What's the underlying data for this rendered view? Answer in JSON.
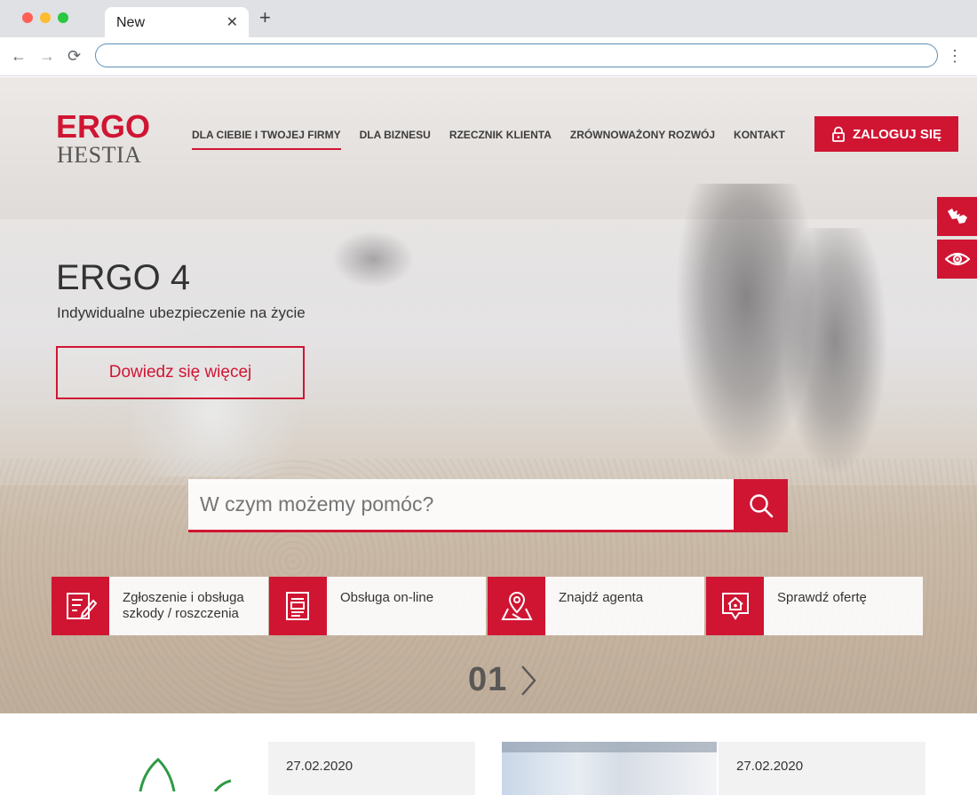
{
  "browser": {
    "tab_title": "New",
    "tab_close": "✕",
    "new_tab": "+",
    "address_value": "",
    "back": "←",
    "forward": "→",
    "reload": "⟳",
    "menu": "⋮"
  },
  "header": {
    "logo_ergo": "ERGO",
    "logo_hestia": "HESTIA",
    "nav": [
      {
        "label": "DLA CIEBIE I TWOJEJ FIRMY",
        "active": true
      },
      {
        "label": "DLA BIZNESU",
        "active": false
      },
      {
        "label": "RZECZNIK KLIENTA",
        "active": false
      },
      {
        "label": "ZRÓWNOWAŻONY ROZWÓJ",
        "active": false
      },
      {
        "label": "KONTAKT",
        "active": false
      }
    ],
    "login_label": "ZALOGUJ SIĘ"
  },
  "side_tabs": {
    "a11y_icon": "sign-language-icon",
    "eye_icon": "eye-icon"
  },
  "hero": {
    "title": "ERGO 4",
    "subtitle": "Indywidualne ubezpieczenie na życie",
    "cta_label": "Dowiedz się więcej",
    "search_placeholder": "W czym możemy pomóc?",
    "slide_number": "01"
  },
  "tiles": [
    {
      "label": "Zgłoszenie i obsługa szkody / roszczenia",
      "icon": "claim-form-icon"
    },
    {
      "label": "Obsługa on-line",
      "icon": "online-document-icon"
    },
    {
      "label": "Znajdź agenta",
      "icon": "map-pin-icon"
    },
    {
      "label": "Sprawdź ofertę",
      "icon": "home-offer-icon"
    }
  ],
  "news": [
    {
      "date": "27.02.2020"
    },
    {
      "date": "27.02.2020"
    }
  ],
  "colors": {
    "brand_red": "#d01533",
    "text_dark": "#333333"
  }
}
